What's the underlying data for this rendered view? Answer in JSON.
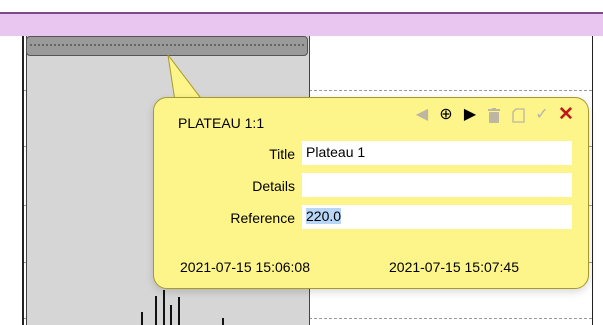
{
  "colors": {
    "band": "#e9c6f0",
    "plateau": "#d6d6d6",
    "callout": "#fdf48a",
    "close": "#c0171b",
    "selection": "#b8d6f5"
  },
  "popup": {
    "title": "PLATEAU 1:1",
    "toolbar": {
      "prev_icon": "triangle-left-icon",
      "move_icon": "crosshair-icon",
      "play_icon": "play-icon",
      "delete_icon": "trash-icon",
      "copy_icon": "copy-icon",
      "confirm_icon": "check-icon",
      "close_icon": "close-x-icon"
    },
    "fields": {
      "title_label": "Title",
      "title_value": "Plateau 1",
      "details_label": "Details",
      "details_value": "",
      "reference_label": "Reference",
      "reference_value": "220.0"
    },
    "start_time": "2021-07-15 15:06:08",
    "end_time": "2021-07-15 15:07:45"
  }
}
